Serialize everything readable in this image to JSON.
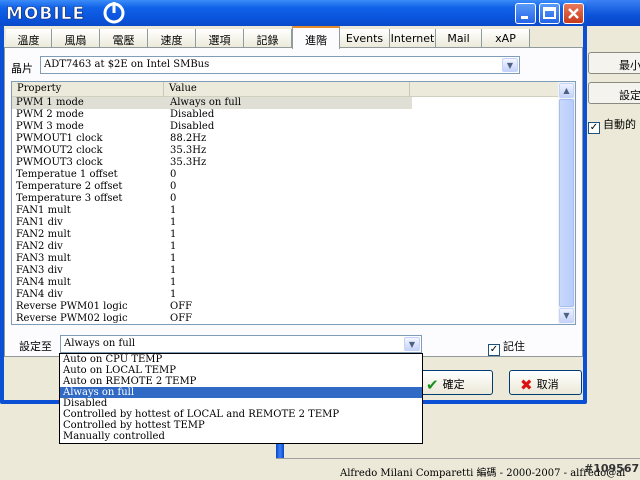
{
  "window": {
    "logo_text": "MOBILE"
  },
  "tabs": [
    {
      "label": "溫度"
    },
    {
      "label": "風扇"
    },
    {
      "label": "電壓"
    },
    {
      "label": "速度"
    },
    {
      "label": "選項"
    },
    {
      "label": "記錄"
    },
    {
      "label": "進階",
      "active": true
    },
    {
      "label": "Events"
    },
    {
      "label": "Internet"
    },
    {
      "label": "Mail"
    },
    {
      "label": "xAP"
    }
  ],
  "chip": {
    "label": "晶片",
    "value": "ADT7463 at $2E on Intel SMBus"
  },
  "table": {
    "headers": [
      "Property",
      "Value"
    ],
    "rows": [
      [
        "PWM 1 mode",
        "Always on full"
      ],
      [
        "PWM 2 mode",
        "Disabled"
      ],
      [
        "PWM 3 mode",
        "Disabled"
      ],
      [
        "PWMOUT1 clock",
        "88.2Hz"
      ],
      [
        "PWMOUT2 clock",
        "35.3Hz"
      ],
      [
        "PWMOUT3 clock",
        "35.3Hz"
      ],
      [
        "Temperatue 1 offset",
        "0"
      ],
      [
        "Temperature 2 offset",
        "0"
      ],
      [
        "Temperature 3 offset",
        "0"
      ],
      [
        "FAN1 mult",
        "1"
      ],
      [
        "FAN1 div",
        "1"
      ],
      [
        "FAN2 mult",
        "1"
      ],
      [
        "FAN2 div",
        "1"
      ],
      [
        "FAN3 mult",
        "1"
      ],
      [
        "FAN3 div",
        "1"
      ],
      [
        "FAN4 mult",
        "1"
      ],
      [
        "FAN4 div",
        "1"
      ],
      [
        "Reverse PWM01 logic",
        "OFF"
      ],
      [
        "Reverse PWM02 logic",
        "OFF"
      ]
    ]
  },
  "set_to": {
    "label": "設定至",
    "value": "Always on full",
    "options": [
      "Auto on CPU TEMP",
      "Auto on LOCAL TEMP",
      "Auto on REMOTE 2 TEMP",
      "Always on full",
      "Disabled",
      "Controlled by hottest of LOCAL and REMOTE 2 TEMP",
      "Controlled by hottest TEMP",
      "Manually controlled"
    ],
    "highlighted": "Always on full"
  },
  "remember": {
    "label": "記住",
    "checked": true
  },
  "buttons": {
    "ok": "確定",
    "cancel": "取消"
  },
  "background_window": {
    "btn_minimize": "最小",
    "btn_settings": "設定",
    "auto_check_label": "自動的",
    "status_text": "Alfredo Milani Comparetti 編碼 - 2000-2007 - alfredo@al",
    "watermark": "#109567"
  },
  "colors": {
    "title_blue": "#0a54dc",
    "selection": "#316ac5",
    "tab_accent": "#e68b2c",
    "cancel_x": "#d11"
  }
}
